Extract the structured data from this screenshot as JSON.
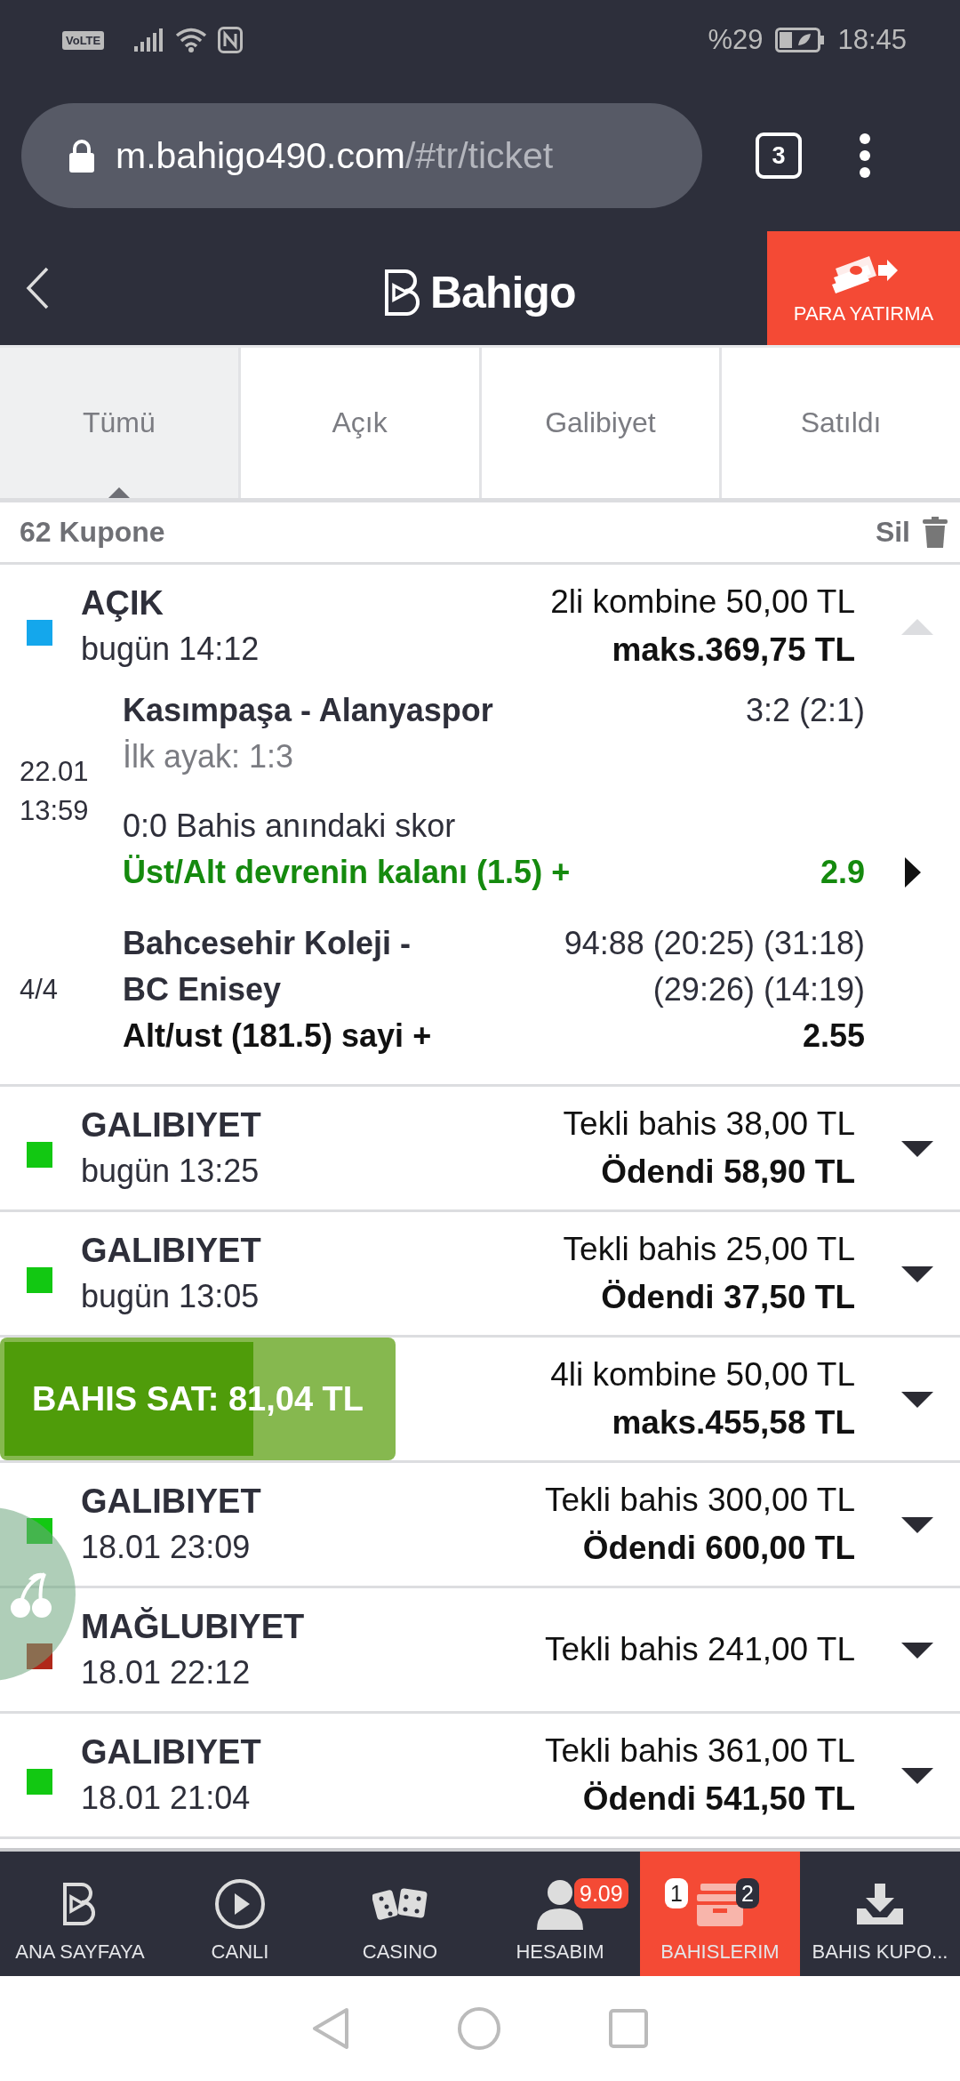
{
  "status_bar": {
    "volte": "VoLTE",
    "battery_text": "%29",
    "time": "18:45"
  },
  "browser": {
    "url_host": "m.bahigo490.com",
    "url_path": "/#tr/ticket",
    "tab_count": "3"
  },
  "header": {
    "logo": "Bahigo",
    "deposit_button": "PARA YATIRMA"
  },
  "tabs": [
    {
      "label": "Tümü",
      "selected": true
    },
    {
      "label": "Açık",
      "selected": false
    },
    {
      "label": "Galibiyet",
      "selected": false
    },
    {
      "label": "Satıldı",
      "selected": false
    }
  ],
  "summary": {
    "count": "62 Kupone",
    "delete": "Sil"
  },
  "tickets": [
    {
      "kind": "bet",
      "status": "AÇIK",
      "color": "#14a7ec",
      "date": "bugün 14:12",
      "stake": "2li kombine 50,00 TL",
      "payout": "maks.369,75 TL",
      "expanded": true,
      "selections": [
        {
          "when": [
            "22.01",
            "13:59"
          ],
          "teams": "Kasımpaşa - Alanyaspor",
          "score": "3:2 (2:1)",
          "note": "İlk ayak: 1:3",
          "bet_score": "0:0 Bahis anındaki skor",
          "market": "Üst/Alt devrenin kalanı (1.5) +",
          "odds": "2.9",
          "won": true,
          "has_details": true
        },
        {
          "when": [
            "4/4"
          ],
          "teams": "Bahcesehir Koleji - BC Enisey",
          "score": "94:88 (20:25) (31:18) (29:26) (14:19)",
          "market": "Alt/ust (181.5) sayi +",
          "odds": "2.55",
          "won": false,
          "has_details": false
        }
      ]
    },
    {
      "kind": "bet",
      "status": "GALIBIYET",
      "color": "#12c812",
      "date": "bugün 13:25",
      "stake": "Tekli bahis 38,00 TL",
      "payout": "Ödendi 58,90 TL",
      "expanded": false
    },
    {
      "kind": "bet",
      "status": "GALIBIYET",
      "color": "#12c812",
      "date": "bugün 13:05",
      "stake": "Tekli bahis 25,00 TL",
      "payout": "Ödendi 37,50 TL",
      "expanded": false
    },
    {
      "kind": "sell",
      "sell_label": "BAHIS SAT:",
      "sell_amount": "81,04 TL",
      "level": 0.63,
      "stake": "4li kombine 50,00 TL",
      "payout": "maks.455,58 TL",
      "expanded": false
    },
    {
      "kind": "bet",
      "status": "GALIBIYET",
      "color": "#12c812",
      "date": "18.01 23:09",
      "stake": "Tekli bahis 300,00 TL",
      "payout": "Ödendi 600,00 TL",
      "expanded": false
    },
    {
      "kind": "bet",
      "status": "MAĞLUBIYET",
      "color": "#b0281a",
      "date": "18.01 22:12",
      "stake": "Tekli bahis 241,00 TL",
      "expanded": false
    },
    {
      "kind": "bet",
      "status": "GALIBIYET",
      "color": "#12c812",
      "date": "18.01 21:04",
      "stake": "Tekli bahis 361,00 TL",
      "payout": "Ödendi 541,50 TL",
      "expanded": false
    }
  ],
  "bottom_nav": [
    {
      "kind": "home",
      "label": "ANA SAYFAYA",
      "selected": false
    },
    {
      "kind": "live",
      "label": "CANLI",
      "selected": false
    },
    {
      "kind": "casino",
      "label": "CASINO",
      "selected": false
    },
    {
      "kind": "account",
      "label": "HESABIM",
      "selected": false,
      "badge": "9.09"
    },
    {
      "kind": "bets",
      "label": "BAHISLERIM",
      "selected": true,
      "badges": [
        "1",
        "2"
      ]
    },
    {
      "kind": "download",
      "label": "BAHIS KUPO...",
      "selected": false
    }
  ]
}
